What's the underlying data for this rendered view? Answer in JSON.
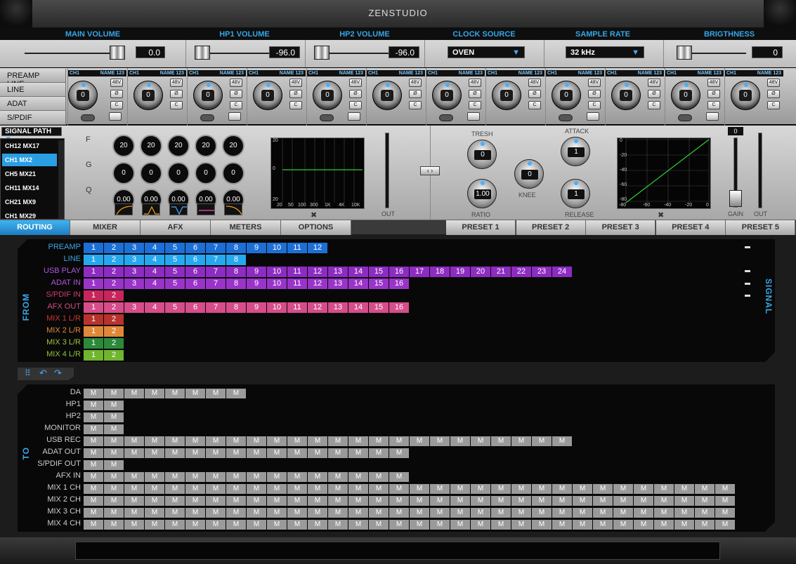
{
  "app": {
    "brand": "ZENSTUDIO"
  },
  "top": {
    "main_volume": {
      "label": "MAIN VOLUME",
      "value": "0.0"
    },
    "hp1_volume": {
      "label": "HP1 VOLUME",
      "value": "-96.0"
    },
    "hp2_volume": {
      "label": "HP2 VOLUME",
      "value": "-96.0"
    },
    "clock_source": {
      "label": "CLOCK SOURCE",
      "value": "OVEN"
    },
    "sample_rate": {
      "label": "SAMPLE RATE",
      "value": "32 kHz"
    },
    "brightness": {
      "label": "BRIGTHNESS",
      "value": "0"
    }
  },
  "input_tabs": [
    "PREAMP LINE",
    "LINE",
    "ADAT",
    "S/PDIF"
  ],
  "strips": [
    {
      "ch": "CH1",
      "name": "NAME 123",
      "gain": "0"
    },
    {
      "ch": "CH1",
      "name": "NAME 123",
      "gain": "0"
    },
    {
      "ch": "CH1",
      "name": "NAME 123",
      "gain": "0"
    },
    {
      "ch": "CH1",
      "name": "NAME 123",
      "gain": "0"
    },
    {
      "ch": "CH1",
      "name": "NAME 123",
      "gain": "0"
    },
    {
      "ch": "CH1",
      "name": "NAME 123",
      "gain": "0"
    },
    {
      "ch": "CH1",
      "name": "NAME 123",
      "gain": "0"
    },
    {
      "ch": "CH1",
      "name": "NAME 123",
      "gain": "0"
    },
    {
      "ch": "CH1",
      "name": "NAME 123",
      "gain": "0"
    },
    {
      "ch": "CH1",
      "name": "NAME 123",
      "gain": "0"
    },
    {
      "ch": "CH1",
      "name": "NAME 123",
      "gain": "0"
    },
    {
      "ch": "CH1",
      "name": "NAME 123",
      "gain": "0"
    }
  ],
  "strip_buttons": {
    "phantom": "48V",
    "phase": "Ø",
    "c": "C"
  },
  "signal_path": {
    "label": "SIGNAL PATH",
    "items": [
      "CH12 MX17",
      "CH1 MX2",
      "CH5 MX21",
      "CH11 MX14",
      "CH21 MX9",
      "CH1 MX29"
    ],
    "selected": 1
  },
  "eq": {
    "labels": [
      "F",
      "G",
      "Q"
    ],
    "f_values": [
      "20",
      "20",
      "20",
      "20",
      "20"
    ],
    "g_values": [
      "0",
      "0",
      "0",
      "0",
      "0"
    ],
    "q_values": [
      "0.00",
      "0.00",
      "0.00",
      "0.00",
      "0.00"
    ],
    "graph_ticks_y": [
      "20",
      "0",
      "20"
    ],
    "graph_ticks_x": [
      "20",
      "50",
      "100",
      "300",
      "1K",
      "4K",
      "10K"
    ],
    "out_label": "OUT"
  },
  "dynamics": {
    "tresh": {
      "label": "TRESH",
      "value": "0"
    },
    "ratio": {
      "label": "RATIO",
      "value": "1.00"
    },
    "knee": {
      "label": "KNEE",
      "value": "0"
    },
    "attack": {
      "label": "ATTACK",
      "value": "1"
    },
    "release": {
      "label": "RELEASE",
      "value": "1"
    },
    "graph_ticks_y": [
      "0",
      "-20",
      "-40",
      "-60",
      "-80"
    ],
    "graph_ticks_x": [
      "-80",
      "-60",
      "-40",
      "-20",
      "0"
    ],
    "gain_value": "0",
    "gain_label": "GAIN",
    "out_label": "OUT"
  },
  "tabs": [
    "ROUTING",
    "MIXER",
    "AFX",
    "METERS",
    "OPTIONS"
  ],
  "presets": [
    "PRESET 1",
    "PRESET 2",
    "PRESET 3",
    "PRESET 4",
    "PRESET 5"
  ],
  "routing": {
    "from_label": "FROM",
    "signal_label": "SIGNAL",
    "to_label": "TO",
    "sources": [
      {
        "name": "PREAMP",
        "count": 12,
        "color": "#1d6fd8",
        "label_color": "#3aa6e6"
      },
      {
        "name": "LINE",
        "count": 8,
        "color": "#26a8f0",
        "label_color": "#3aa6e6"
      },
      {
        "name": "USB PLAY",
        "count": 24,
        "color": "#8e2bc2",
        "label_color": "#b154e2"
      },
      {
        "name": "ADAT IN",
        "count": 16,
        "color": "#9a34c8",
        "label_color": "#b154e2"
      },
      {
        "name": "S/PDIF IN",
        "count": 2,
        "color": "#c8265a",
        "label_color": "#d23a6a"
      },
      {
        "name": "AFX OUT",
        "count": 16,
        "color": "#d64d8a",
        "label_color": "#d64d8a"
      },
      {
        "name": "MIX 1 L/R",
        "count": 2,
        "color": "#b8322e",
        "label_color": "#c8382e"
      },
      {
        "name": "MIX 2 L/R",
        "count": 2,
        "color": "#e0883a",
        "label_color": "#e08a3a"
      },
      {
        "name": "MIX 3 L/R",
        "count": 2,
        "color": "#2b8a3a",
        "label_color": "#9ac83a"
      },
      {
        "name": "MIX 4 L/R",
        "count": 2,
        "color": "#6fb52e",
        "label_color": "#8ec43a"
      }
    ],
    "destinations": [
      {
        "name": "DA",
        "count": 8
      },
      {
        "name": "HP1",
        "count": 2
      },
      {
        "name": "HP2",
        "count": 2
      },
      {
        "name": "MONITOR",
        "count": 2
      },
      {
        "name": "USB REC",
        "count": 24
      },
      {
        "name": "ADAT OUT",
        "count": 16
      },
      {
        "name": "S/PDIF OUT",
        "count": 2
      },
      {
        "name": "AFX IN",
        "count": 16
      },
      {
        "name": "MIX 1 CH",
        "count": 32
      },
      {
        "name": "MIX 2 CH",
        "count": 32
      },
      {
        "name": "MIX 3 CH",
        "count": 32
      },
      {
        "name": "MIX 4 CH",
        "count": 32
      }
    ],
    "mute_label": "M"
  }
}
